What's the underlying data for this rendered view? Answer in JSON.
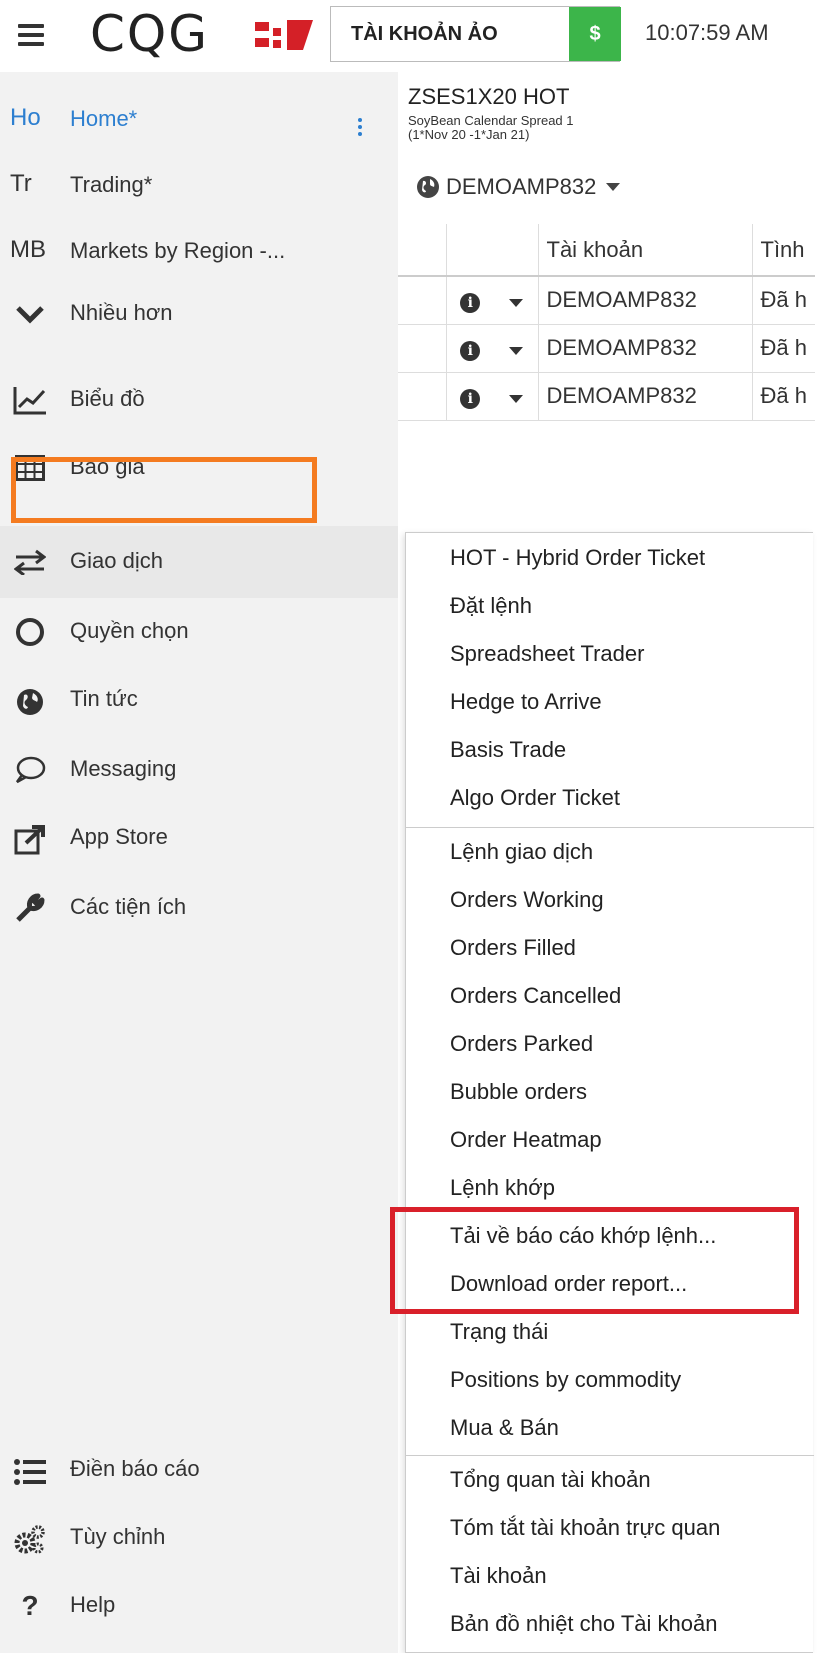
{
  "header": {
    "logo_text": "CQG",
    "account_label": "TÀI KHOẢN ẢO",
    "dollar_label": "$",
    "time": "10:07:59 AM"
  },
  "sidebar": {
    "items": [
      {
        "abbr": "Ho",
        "label": "Home*",
        "active": true
      },
      {
        "abbr": "Tr",
        "label": "Trading*"
      },
      {
        "abbr": "MB",
        "label": "Markets by Region -..."
      },
      {
        "icon": "chevron-down-icon",
        "label": "Nhiều hơn"
      },
      {
        "icon": "line-chart-icon",
        "label": "Biểu đồ"
      },
      {
        "icon": "table-grid-icon",
        "label": "Báo giá"
      },
      {
        "icon": "exchange-arrows-icon",
        "label": "Giao dịch"
      },
      {
        "icon": "circle-outline-icon",
        "label": "Quyền chọn"
      },
      {
        "icon": "globe-icon",
        "label": "Tin tức"
      },
      {
        "icon": "speech-bubble-icon",
        "label": "Messaging"
      },
      {
        "icon": "external-link-icon",
        "label": "App Store"
      },
      {
        "icon": "wrench-icon",
        "label": "Các tiện ích"
      }
    ],
    "bottom_items": [
      {
        "icon": "list-icon",
        "label": "Điền báo cáo"
      },
      {
        "icon": "gears-icon",
        "label": "Tùy chỉnh"
      },
      {
        "icon": "question-icon",
        "label": "Help"
      }
    ]
  },
  "instrument": {
    "symbol": "ZSES1X20 HOT",
    "description_line1": "SoyBean Calendar Spread 1",
    "description_line2": "(1*Nov 20 -1*Jan 21)"
  },
  "account_selector": {
    "value": "DEMOAMP832"
  },
  "orders_table": {
    "headers": [
      "",
      "",
      "",
      "Tài khoản",
      "Tình"
    ],
    "rows": [
      {
        "account": "DEMOAMP832",
        "status": "Đã h"
      },
      {
        "account": "DEMOAMP832",
        "status": "Đã h"
      },
      {
        "account": "DEMOAMP832",
        "status": "Đã h"
      }
    ]
  },
  "menu": {
    "group1": [
      "HOT - Hybrid Order Ticket",
      "Đặt lệnh",
      "Spreadsheet Trader",
      "Hedge to Arrive",
      "Basis Trade",
      "Algo Order Ticket"
    ],
    "group2": [
      "Lệnh giao dịch",
      "Orders Working",
      "Orders Filled",
      "Orders Cancelled",
      "Orders Parked",
      "Bubble orders",
      "Order Heatmap",
      "Lệnh khớp",
      "Tải về báo cáo khớp lệnh...",
      "Download order report...",
      "Trạng thái",
      "Positions by commodity",
      "Mua & Bán"
    ],
    "group3": [
      "Tổng quan tài khoản",
      "Tóm tắt tài khoản trực quan",
      "Tài khoản",
      "Bản đồ nhiệt cho Tài khoản"
    ]
  },
  "colors": {
    "accent_blue": "#2d7fd0",
    "highlight_orange": "#f47b20",
    "highlight_red": "#d9202a",
    "dollar_green": "#3cb54a"
  }
}
